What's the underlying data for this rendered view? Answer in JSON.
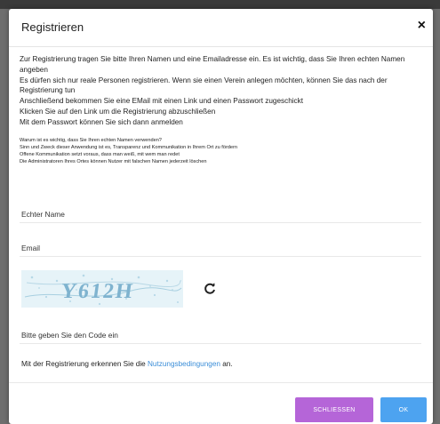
{
  "dialog": {
    "title": "Registrieren",
    "close_symbol": "×"
  },
  "intro": [
    "Zur Registrierung tragen Sie bitte Ihren Namen und eine Emailadresse ein. Es ist wichtig, dass Sie Ihren echten Namen angeben",
    "Es dürfen sich nur reale Personen registrieren. Wenn sie einen Verein anlegen möchten, können Sie das nach der Registrierung tun",
    "Anschließend bekommen Sie eine EMail mit einen Link und einen Passwort zugeschickt",
    "Klicken Sie auf den Link um die Registrierung abzuschließen",
    "Mit dem Passwort können Sie sich dann anmelden"
  ],
  "info": [
    "Warum ist es wichtig, dass Sie Ihren echten Namen verwenden?",
    "Sinn und Zweck dieser Anwendung ist es, Transparenz und Kommunikation in Ihrem Ort zu fördern",
    "Offene Kommunikation setzt voraus, dass man weiß, mit wem man redet",
    "Die Administratoren Ihres Ortes können Nutzer mit falschen Namen jederzeit löschen"
  ],
  "form": {
    "name_label": "Echter Name",
    "email_label": "Email",
    "captcha_text": "Y612H",
    "code_label": "Bitte geben Sie den Code ein"
  },
  "terms": {
    "prefix": "Mit der Registrierung erkennen Sie die",
    "link": "Nutzungsbedingungen",
    "suffix": "an."
  },
  "footer": {
    "close_label": "SCHLIESSEN",
    "ok_label": "OK"
  },
  "colors": {
    "primary": "#4da3f0",
    "secondary": "#b565d8",
    "link": "#3b8ed8"
  }
}
